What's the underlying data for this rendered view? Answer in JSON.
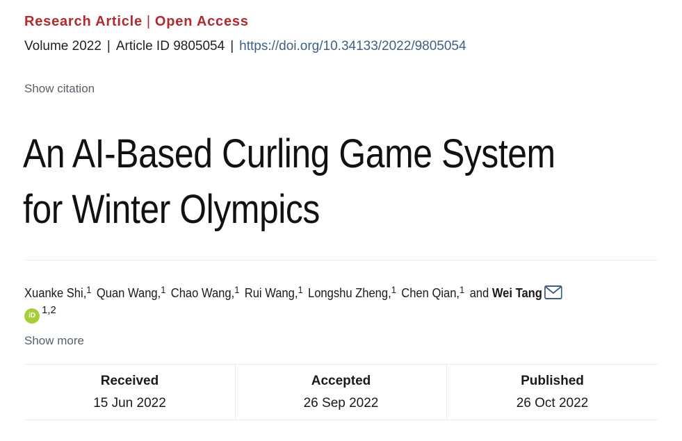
{
  "header": {
    "article_type": "Research Article",
    "separator": "|",
    "access": "Open Access"
  },
  "meta": {
    "volume": "Volume 2022",
    "pipe1": "|",
    "article_id": "Article ID 9805054",
    "pipe2": "|",
    "doi": "https://doi.org/10.34133/2022/9805054"
  },
  "show_citation": "Show citation",
  "title_lines": [
    "An AI-Based Curling Game System",
    "for Winter Olympics"
  ],
  "authors": [
    {
      "name": "Xuanke Shi,",
      "aff": "1"
    },
    {
      "name": "Quan Wang,",
      "aff": "1"
    },
    {
      "name": "Chao Wang,",
      "aff": "1"
    },
    {
      "name": "Rui Wang,",
      "aff": "1"
    },
    {
      "name": "Longshu Zheng,",
      "aff": "1"
    },
    {
      "name": "Chen Qian,",
      "aff": "1"
    }
  ],
  "and_text": "and",
  "corresponding_author": {
    "name": "Wei Tang",
    "aff": "1,2"
  },
  "orcid_label": "iD",
  "show_more": "Show more",
  "dates": {
    "received": {
      "label": "Received",
      "value": "15 Jun 2022"
    },
    "accepted": {
      "label": "Accepted",
      "value": "26 Sep 2022"
    },
    "published": {
      "label": "Published",
      "value": "26 Oct 2022"
    }
  },
  "colors": {
    "article_type": "#b12a30",
    "doi_link": "#3f5f84",
    "orcid": "#a6ce39"
  }
}
